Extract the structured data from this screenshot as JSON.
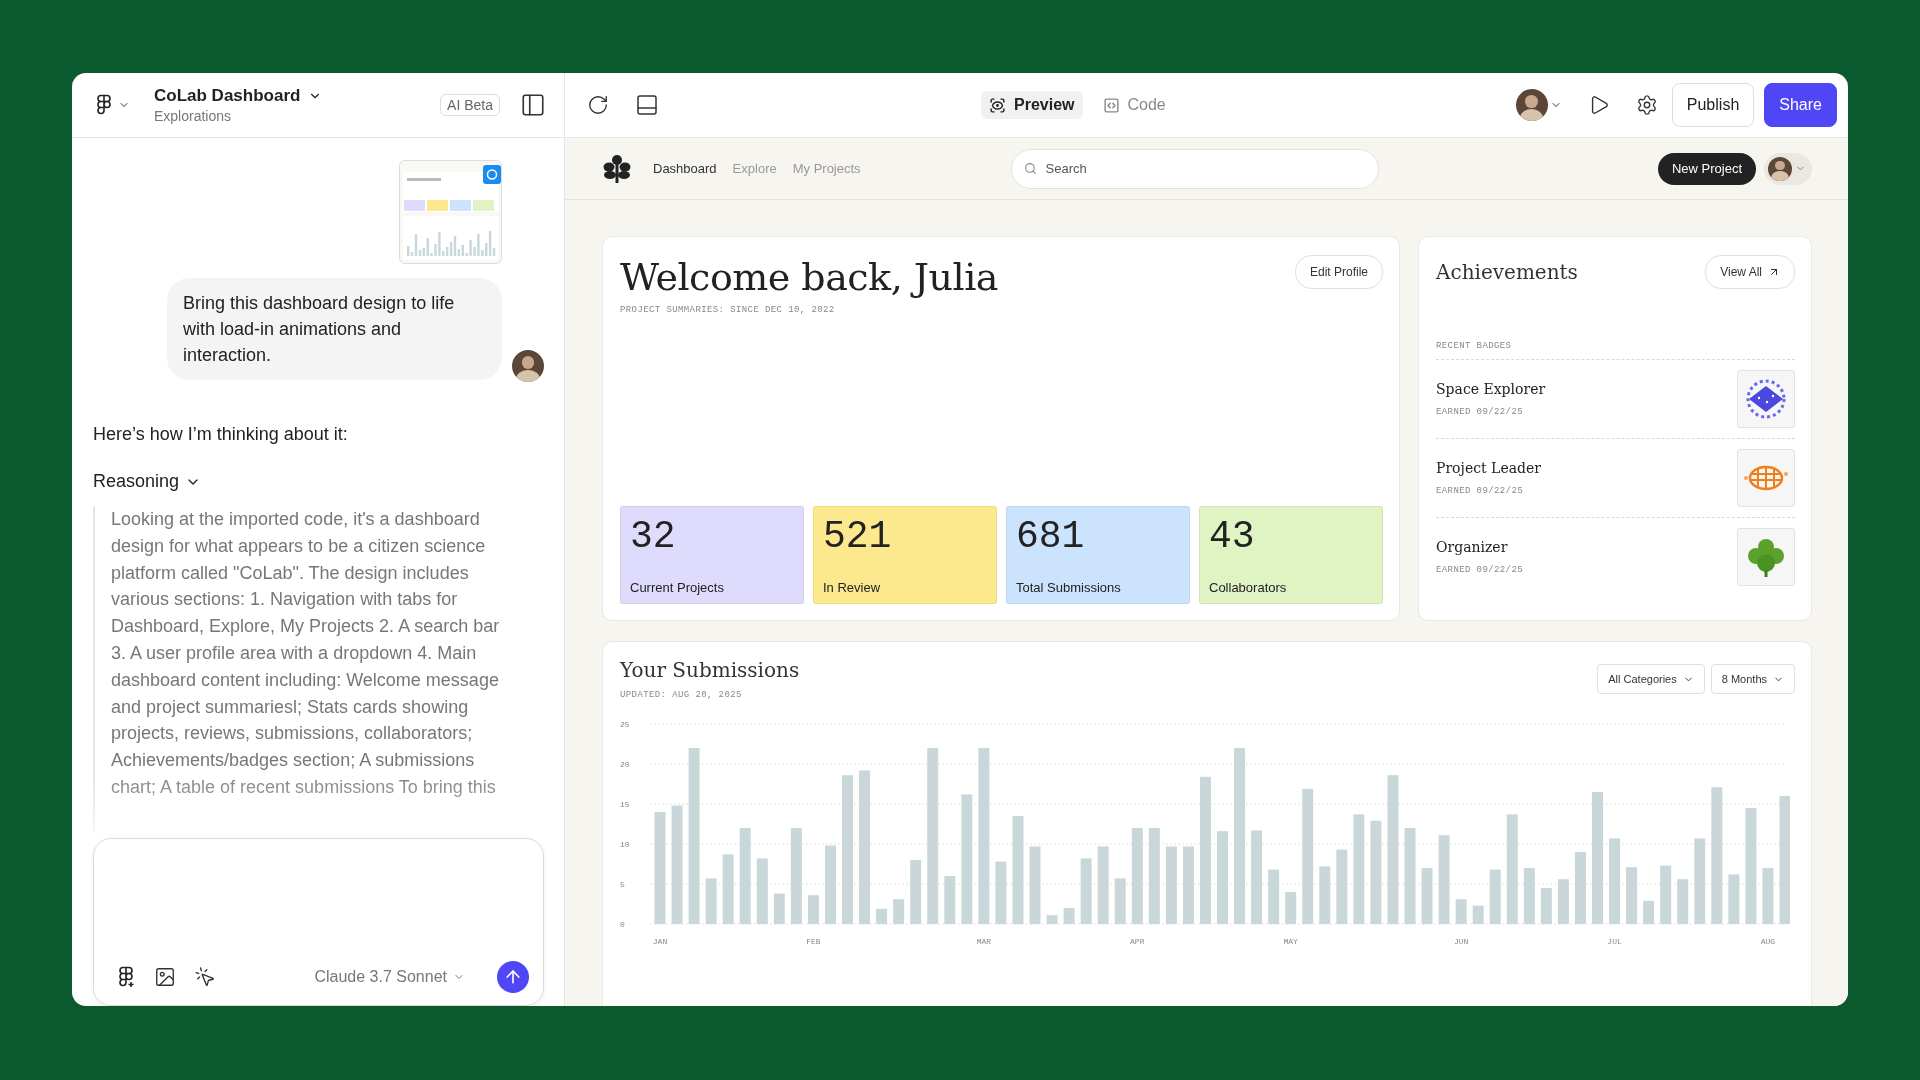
{
  "editor": {
    "title": "CoLab Dashboard",
    "subtitle": "Explorations",
    "badge": "AI Beta"
  },
  "chat": {
    "message": {
      "text": "Bring this dashboard design to life with load-in animations and interaction.",
      "has_attachment": true
    },
    "reply": "Here’s how I’m thinking about it:",
    "reasoning": {
      "label": "Reasoning",
      "expanded": true,
      "text": "Looking at the imported code, it's a dashboard design for what appears to be a citizen science platform called \"CoLab\". The design includes various sections: 1. Navigation with tabs for Dashboard, Explore, My Projects 2. A search bar 3. A user profile area with a dropdown 4. Main dashboard content including: Welcome message and project summariesl; Stats cards showing projects, reviews, submissions, collaborators; Achievements/badges section; A submissions chart; A table of recent submissions To bring this"
    },
    "composer": {
      "model": "Claude 3.7 Sonnet"
    }
  },
  "toolbar": {
    "view_tabs": [
      {
        "label": "Preview",
        "kind": "preview",
        "selected": true
      },
      {
        "label": "Code",
        "kind": "code",
        "selected": false
      }
    ],
    "buttons": [
      {
        "label": "Publish",
        "kind": "secondary"
      },
      {
        "label": "Share",
        "kind": "primary"
      }
    ]
  },
  "preview": {
    "nav": [
      {
        "label": "Dashboard",
        "selected": true
      },
      {
        "label": "Explore",
        "selected": false
      },
      {
        "label": "My Projects",
        "selected": false
      }
    ],
    "search": {
      "placeholder": "Search"
    },
    "new_project": "New Project"
  },
  "welcome": {
    "title": "Welcome back, Julia",
    "subtitle": "PROJECT SUMMARIES: SINCE DEC 10, 2022",
    "edit": "Edit Profile",
    "stats": [
      {
        "value": "32",
        "label": "Current Projects",
        "color": "#dedbfc"
      },
      {
        "value": "521",
        "label": "In Review",
        "color": "#fce98e"
      },
      {
        "value": "681",
        "label": "Total Submissions",
        "color": "#cce3fd"
      },
      {
        "value": "43",
        "label": "Collaborators",
        "color": "#e0f3c2"
      }
    ]
  },
  "achievements": {
    "title": "Achievements",
    "view_all": "View All",
    "section": "RECENT BADGES",
    "badges": [
      {
        "name": "Space Explorer",
        "earned": "EARNED 09/22/25",
        "kind": "planet"
      },
      {
        "name": "Project Leader",
        "earned": "EARNED 09/22/25",
        "kind": "globe"
      },
      {
        "name": "Organizer",
        "earned": "EARNED 09/22/25",
        "kind": "leaf"
      }
    ]
  },
  "submissions": {
    "title": "Your Submissions",
    "updated": "UPDATED: AUG 20, 2025",
    "filters": [
      "All Categories",
      "8 Months"
    ],
    "chart_data": {
      "type": "bar",
      "ylim": [
        0,
        25
      ],
      "yticks": [
        0,
        5,
        10,
        15,
        20,
        25
      ],
      "grid": true,
      "categories": [
        "JAN",
        null,
        null,
        null,
        null,
        null,
        null,
        null,
        null,
        "FEB",
        null,
        null,
        null,
        null,
        null,
        null,
        null,
        null,
        null,
        "MAR",
        null,
        null,
        null,
        null,
        null,
        null,
        null,
        null,
        "APR",
        null,
        null,
        null,
        null,
        null,
        null,
        null,
        null,
        "MAY",
        null,
        null,
        null,
        null,
        null,
        null,
        null,
        null,
        null,
        "JUN",
        null,
        null,
        null,
        null,
        null,
        null,
        null,
        null,
        "JUL",
        null,
        null,
        null,
        null,
        null,
        null,
        null,
        null,
        "AUG",
        null
      ],
      "values": [
        14,
        14.8,
        22,
        5.7,
        8.7,
        12,
        8.2,
        3.8,
        12,
        3.6,
        9.8,
        18.6,
        19.2,
        1.9,
        3.1,
        8,
        22,
        6,
        16.2,
        22,
        7.8,
        13.5,
        9.7,
        1.1,
        2,
        8.2,
        9.7,
        5.7,
        12,
        12,
        9.7,
        9.7,
        18.4,
        11.6,
        22,
        11.7,
        6.8,
        4,
        16.9,
        7.2,
        9.3,
        13.7,
        12.9,
        18.6,
        12,
        7,
        11.1,
        3.1,
        2.3,
        6.8,
        13.7,
        7,
        4.5,
        5.6,
        9,
        16.5,
        10.7,
        7.1,
        2.9,
        7.3,
        5.6,
        10.7,
        17.1,
        6.2,
        14.5,
        7,
        16
      ]
    }
  }
}
